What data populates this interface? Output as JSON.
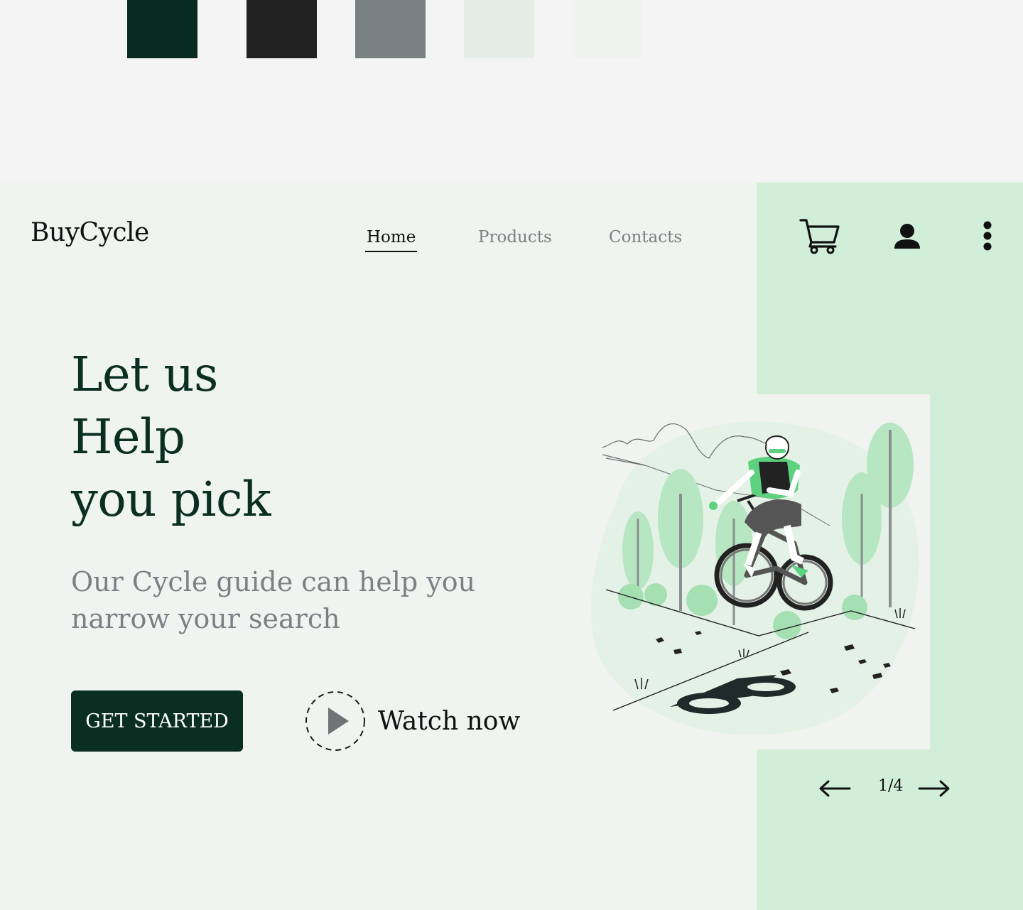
{
  "palette": {
    "colors": [
      "#072b21",
      "#212121",
      "#798082",
      "#e3ede5",
      "#eef3ef"
    ]
  },
  "brand": {
    "name": "BuyCycle"
  },
  "nav": {
    "home": "Home",
    "products": "Products",
    "contacts": "Contacts"
  },
  "icons": {
    "cart": "cart-icon",
    "user": "user-icon",
    "more": "more-vertical-icon"
  },
  "hero": {
    "headline_line1": "Let us",
    "headline_line2": "Help",
    "headline_line3": "you pick",
    "subtext": "Our Cycle guide can help you narrow your search",
    "cta_label": "GET STARTED",
    "watch_label": "Watch now"
  },
  "slider": {
    "current": "1/4"
  },
  "colors": {
    "primary": "#0a2e22",
    "side_panel": "#d1eed8",
    "background": "#eff4f0",
    "muted_text": "#7a8084",
    "accent_green": "#5ed17f"
  }
}
